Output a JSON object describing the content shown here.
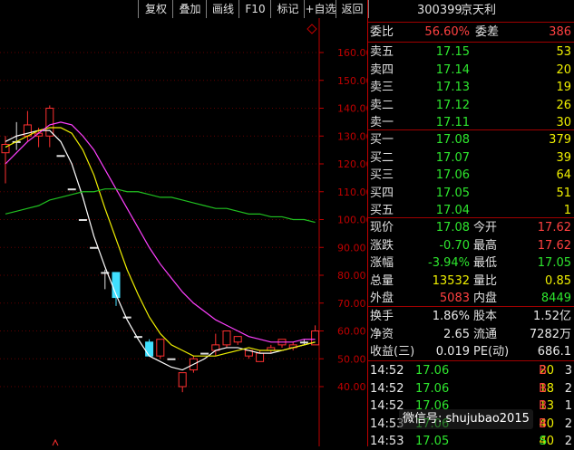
{
  "toolbar": {
    "buttons": [
      "复权",
      "叠加",
      "画线",
      "F10",
      "标记",
      "+自选",
      "返回"
    ]
  },
  "header": {
    "code": "300399",
    "name": "京天利"
  },
  "quote": {
    "weibi_label": "委比",
    "weibi_value": "56.60%",
    "weicha_label": "委差",
    "weicha_value": "386",
    "asks": [
      {
        "label": "卖五",
        "price": "17.15",
        "vol": "53"
      },
      {
        "label": "卖四",
        "price": "17.14",
        "vol": "20"
      },
      {
        "label": "卖三",
        "price": "17.13",
        "vol": "19"
      },
      {
        "label": "卖二",
        "price": "17.12",
        "vol": "26"
      },
      {
        "label": "卖一",
        "price": "17.11",
        "vol": "30"
      }
    ],
    "bids": [
      {
        "label": "买一",
        "price": "17.08",
        "vol": "379"
      },
      {
        "label": "买二",
        "price": "17.07",
        "vol": "39"
      },
      {
        "label": "买三",
        "price": "17.06",
        "vol": "64"
      },
      {
        "label": "买四",
        "price": "17.05",
        "vol": "51"
      },
      {
        "label": "买五",
        "price": "17.04",
        "vol": "1"
      }
    ],
    "stats": [
      {
        "l1": "现价",
        "v1": "17.08",
        "l2": "今开",
        "v2": "17.62"
      },
      {
        "l1": "涨跌",
        "v1": "-0.70",
        "l2": "最高",
        "v2": "17.62"
      },
      {
        "l1": "涨幅",
        "v1": "-3.94%",
        "l2": "最低",
        "v2": "17.05"
      },
      {
        "l1": "总量",
        "v1": "13532",
        "l2": "量比",
        "v2": "0.85"
      },
      {
        "l1": "外盘",
        "v1": "5083",
        "l2": "内盘",
        "v2": "8449"
      }
    ],
    "stats2": [
      {
        "l1": "换手",
        "v1": "1.86%",
        "l2": "股本",
        "v2": "1.52亿"
      },
      {
        "l1": "净资",
        "v1": "2.65",
        "l2": "流通",
        "v2": "7282万"
      },
      {
        "l1": "收益(三)",
        "v1": "0.019",
        "l2": "PE(动)",
        "v2": "686.1"
      }
    ]
  },
  "ticks": [
    {
      "time": "14:52",
      "price": "17.06",
      "vol": "20",
      "flag": "B",
      "n": "3"
    },
    {
      "time": "14:52",
      "price": "17.06",
      "vol": "18",
      "flag": "B",
      "n": "2"
    },
    {
      "time": "14:52",
      "price": "17.06",
      "vol": "13",
      "flag": "B",
      "n": "1"
    },
    {
      "time": "14:53",
      "price": "17.06",
      "vol": "40",
      "flag": "B",
      "n": "2"
    },
    {
      "time": "14:53",
      "price": "17.05",
      "vol": "40",
      "flag": "S",
      "n": "2"
    }
  ],
  "watermark": "微信号: shujubao2015",
  "chart_data": {
    "type": "candlestick",
    "y_ticks": [
      "160.00",
      "150.00",
      "140.00",
      "130.00",
      "120.00",
      "110.00",
      "100.00",
      "90.00",
      "80.00",
      "70.00",
      "60.00",
      "50.00",
      "40.00"
    ],
    "ylim": [
      34,
      166
    ],
    "candles": [
      {
        "o": 124,
        "c": 127,
        "h": 130,
        "l": 113
      },
      {
        "o": 128,
        "c": 128,
        "h": 135,
        "l": 125
      },
      {
        "o": 130,
        "c": 134,
        "h": 139,
        "l": 128
      },
      {
        "o": 130,
        "c": 131,
        "h": 133,
        "l": 126
      },
      {
        "o": 130,
        "c": 140,
        "h": 141,
        "l": 126
      },
      {
        "o": 123,
        "c": 123,
        "h": 123,
        "l": 123
      },
      {
        "o": 111,
        "c": 111,
        "h": 111,
        "l": 111
      },
      {
        "o": 100,
        "c": 100,
        "h": 100,
        "l": 100
      },
      {
        "o": 90,
        "c": 90,
        "h": 90,
        "l": 90
      },
      {
        "o": 81,
        "c": 81,
        "h": 82,
        "l": 75
      },
      {
        "o": 81,
        "c": 72,
        "h": 81,
        "l": 69
      },
      {
        "o": 65,
        "c": 65,
        "h": 65,
        "l": 65
      },
      {
        "o": 58,
        "c": 58,
        "h": 58,
        "l": 58
      },
      {
        "o": 56,
        "c": 51,
        "h": 57,
        "l": 51
      },
      {
        "o": 51,
        "c": 57,
        "h": 57,
        "l": 50
      },
      {
        "o": 50,
        "c": 50,
        "h": 50,
        "l": 50
      },
      {
        "o": 40,
        "c": 45,
        "h": 45,
        "l": 38
      },
      {
        "o": 46,
        "c": 50,
        "h": 51,
        "l": 45
      },
      {
        "o": 52,
        "c": 52,
        "h": 52,
        "l": 52
      },
      {
        "o": 53,
        "c": 55,
        "h": 59,
        "l": 51
      },
      {
        "o": 55,
        "c": 60,
        "h": 60,
        "l": 54
      },
      {
        "o": 56,
        "c": 58,
        "h": 58,
        "l": 55
      },
      {
        "o": 51,
        "c": 53,
        "h": 53,
        "l": 50
      },
      {
        "o": 49,
        "c": 52,
        "h": 53,
        "l": 49
      },
      {
        "o": 53,
        "c": 54,
        "h": 55,
        "l": 52
      },
      {
        "o": 55,
        "c": 57,
        "h": 57,
        "l": 54
      },
      {
        "o": 54,
        "c": 55,
        "h": 56,
        "l": 53
      },
      {
        "o": 56,
        "c": 56,
        "h": 57,
        "l": 55
      },
      {
        "o": 55,
        "c": 60,
        "h": 62,
        "l": 55
      }
    ],
    "ma_lines": [
      {
        "color": "#ffffff",
        "values": [
          128,
          130,
          131,
          132,
          132,
          128,
          120,
          108,
          94,
          83,
          73,
          64,
          57,
          51,
          49,
          47,
          46,
          48,
          50,
          53,
          54,
          54,
          53,
          52,
          52,
          53,
          54,
          55,
          56
        ]
      },
      {
        "color": "#f0f000",
        "values": [
          126,
          128,
          130,
          132,
          133,
          133,
          131,
          125,
          116,
          104,
          93,
          82,
          73,
          65,
          59,
          55,
          53,
          51,
          51,
          51,
          52,
          53,
          54,
          53,
          53,
          53,
          54,
          55,
          56
        ]
      },
      {
        "color": "#ff40ff",
        "values": [
          120,
          124,
          128,
          131,
          134,
          135,
          134,
          130,
          125,
          118,
          111,
          104,
          97,
          90,
          84,
          79,
          74,
          70,
          67,
          64,
          62,
          60,
          58,
          57,
          56,
          56,
          56,
          57,
          57
        ]
      },
      {
        "color": "#20c020",
        "values": [
          102,
          103,
          104,
          105,
          107,
          108,
          109,
          110,
          110,
          111,
          111,
          110,
          110,
          109,
          108,
          108,
          107,
          106,
          105,
          104,
          104,
          103,
          102,
          102,
          101,
          101,
          100,
          100,
          99
        ]
      }
    ]
  }
}
